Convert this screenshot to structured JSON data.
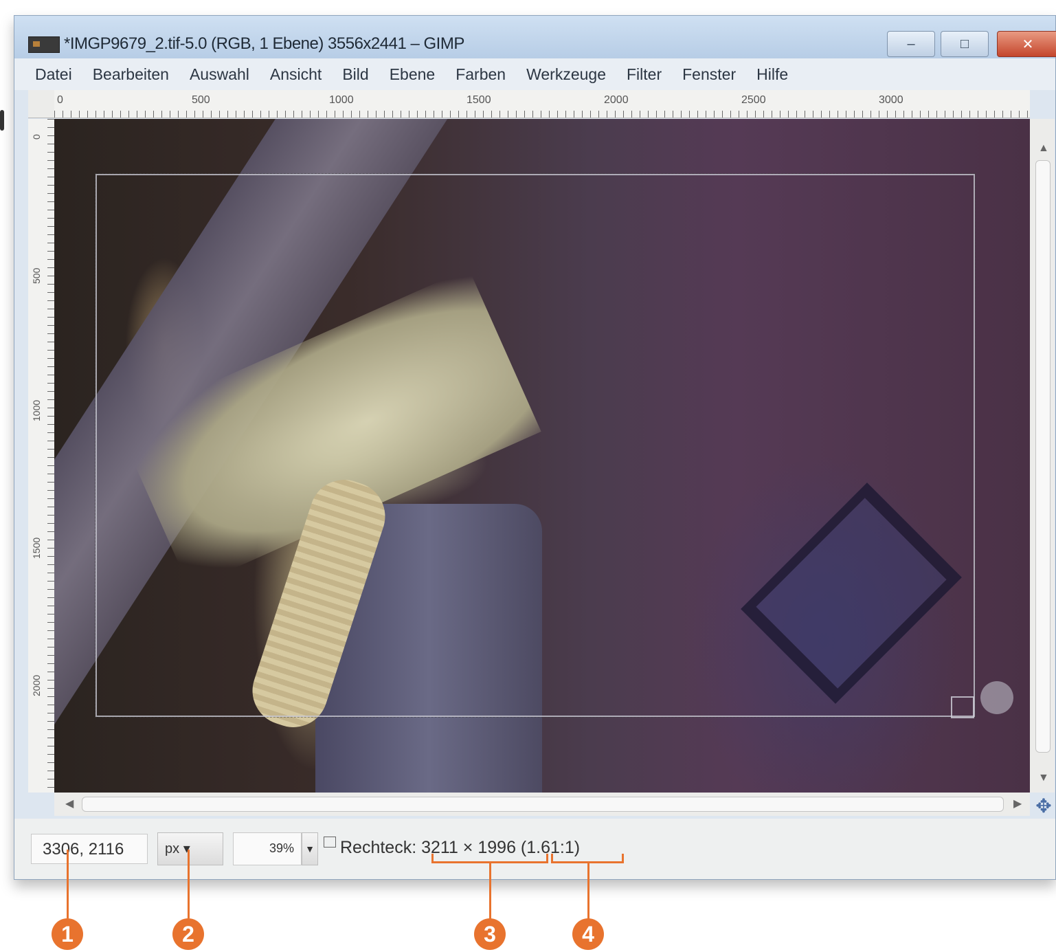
{
  "window": {
    "title": "*IMGP9679_2.tif-5.0 (RGB, 1 Ebene) 3556x2441 – GIMP",
    "min_label": "–",
    "max_label": "□",
    "close_label": "✕"
  },
  "menu": [
    {
      "label": "Datei"
    },
    {
      "label": "Bearbeiten"
    },
    {
      "label": "Auswahl"
    },
    {
      "label": "Ansicht"
    },
    {
      "label": "Bild"
    },
    {
      "label": "Ebene"
    },
    {
      "label": "Farben"
    },
    {
      "label": "Werkzeuge"
    },
    {
      "label": "Filter"
    },
    {
      "label": "Fenster"
    },
    {
      "label": "Hilfe"
    }
  ],
  "ruler": {
    "h_ticks": [
      "0",
      "500",
      "1000",
      "1500",
      "2000",
      "2500",
      "3000"
    ],
    "v_ticks": [
      "0",
      "500",
      "1000",
      "1500",
      "2000"
    ]
  },
  "status": {
    "coords": "3306, 2116",
    "unit": "px",
    "zoom": "39%",
    "message": "Rechteck: 3211 × 1996 (1.61:1)"
  },
  "callouts": [
    "1",
    "2",
    "3",
    "4"
  ],
  "colors": {
    "accent": "#e8732e",
    "titlebar": "#b7cde6"
  }
}
